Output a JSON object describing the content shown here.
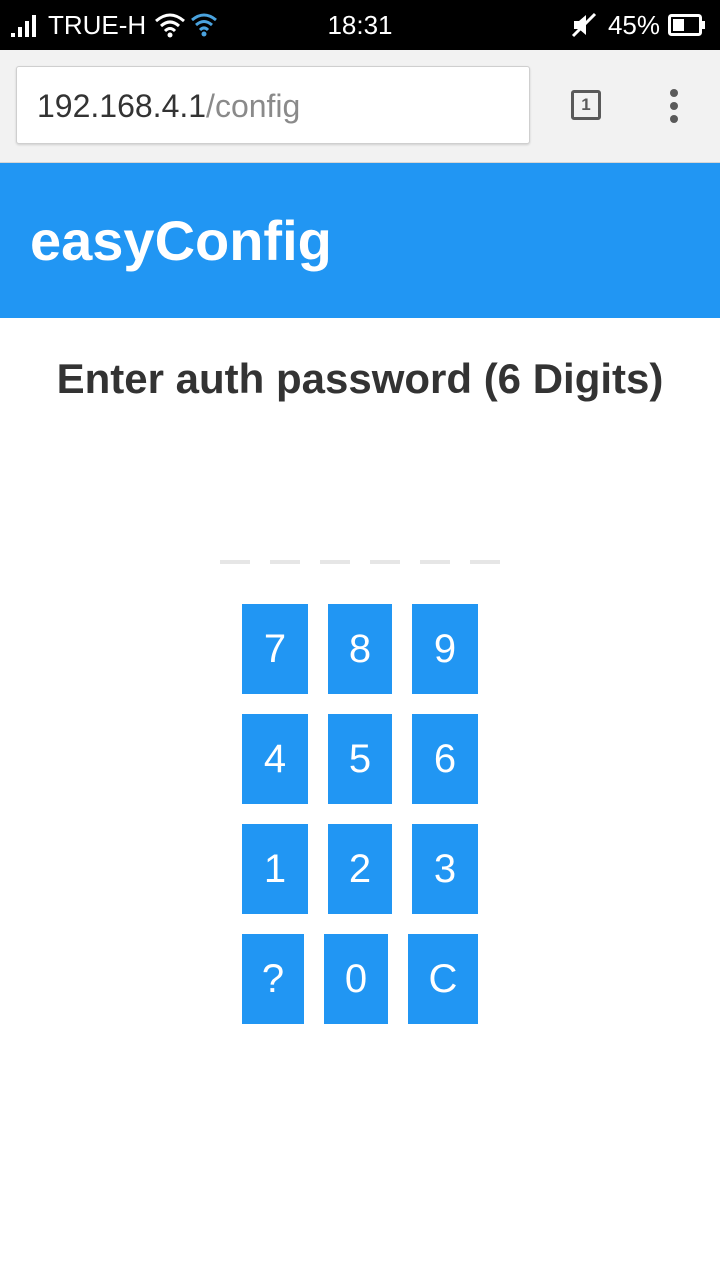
{
  "status_bar": {
    "carrier": "TRUE-H",
    "time": "18:31",
    "battery_percent": "45%",
    "battery_level": 0.45
  },
  "browser": {
    "url_host": "192.168.4.1",
    "url_path": "/config",
    "tab_count": "1"
  },
  "app": {
    "title": "easyConfig",
    "accent_color": "#2196f3"
  },
  "auth": {
    "prompt": "Enter auth password (6 Digits)",
    "digit_slots": 6,
    "entered_digits": 0
  },
  "keypad": {
    "rows": [
      [
        "7",
        "8",
        "9"
      ],
      [
        "4",
        "5",
        "6"
      ],
      [
        "1",
        "2",
        "3"
      ],
      [
        "?",
        "0",
        "C"
      ]
    ]
  }
}
